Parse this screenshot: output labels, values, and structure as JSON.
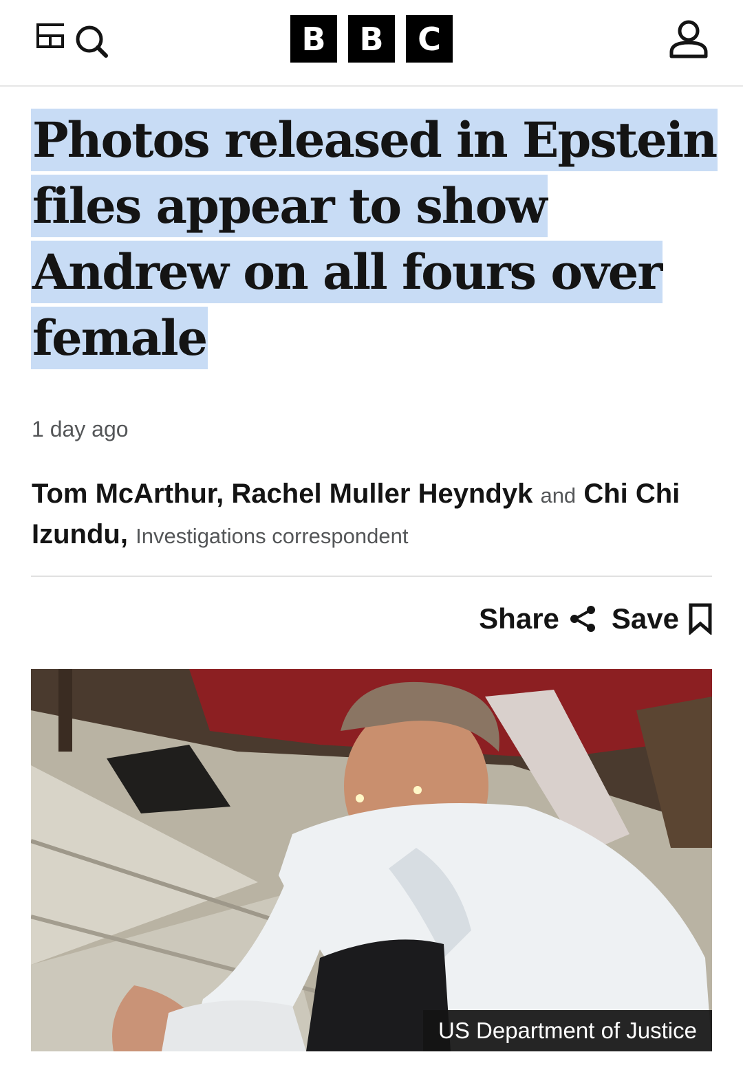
{
  "header": {
    "logo_letters": [
      "B",
      "B",
      "C"
    ],
    "icons": [
      "menu-icon",
      "search-icon",
      "account-icon"
    ]
  },
  "article": {
    "headline": "Photos released in Epstein files appear to show Andrew on all fours over female",
    "timestamp": "1 day ago",
    "byline": {
      "author_1": "Tom McArthur,",
      "author_2": "Rachel Muller Heyndyk",
      "and": "and",
      "author_3": "Chi Chi Izundu,",
      "role": "Investigations correspondent"
    },
    "actions": {
      "share_label": "Share",
      "save_label": "Save"
    },
    "image": {
      "credit": "US Department of Justice"
    }
  },
  "colors": {
    "highlight": "#c8dcf5",
    "text": "#141414",
    "muted": "#545658"
  }
}
